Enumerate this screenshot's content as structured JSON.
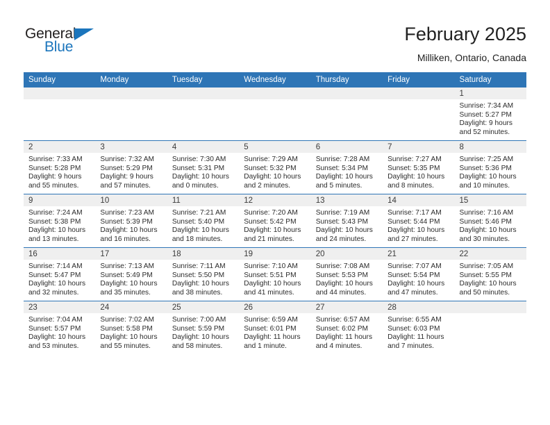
{
  "brand": {
    "name_dark": "General",
    "name_blue": "Blue",
    "accent_color": "#1B75BC"
  },
  "header": {
    "title": "February 2025",
    "subtitle": "Milliken, Ontario, Canada",
    "header_bg_color": "#2E75B6",
    "day_band_color": "#EFEFEF"
  },
  "weekday_headers": [
    "Sunday",
    "Monday",
    "Tuesday",
    "Wednesday",
    "Thursday",
    "Friday",
    "Saturday"
  ],
  "weeks": [
    [
      {
        "day": "",
        "sunrise": "",
        "sunset": "",
        "daylight_1": "",
        "daylight_2": ""
      },
      {
        "day": "",
        "sunrise": "",
        "sunset": "",
        "daylight_1": "",
        "daylight_2": ""
      },
      {
        "day": "",
        "sunrise": "",
        "sunset": "",
        "daylight_1": "",
        "daylight_2": ""
      },
      {
        "day": "",
        "sunrise": "",
        "sunset": "",
        "daylight_1": "",
        "daylight_2": ""
      },
      {
        "day": "",
        "sunrise": "",
        "sunset": "",
        "daylight_1": "",
        "daylight_2": ""
      },
      {
        "day": "",
        "sunrise": "",
        "sunset": "",
        "daylight_1": "",
        "daylight_2": ""
      },
      {
        "day": "1",
        "sunrise": "Sunrise: 7:34 AM",
        "sunset": "Sunset: 5:27 PM",
        "daylight_1": "Daylight: 9 hours",
        "daylight_2": "and 52 minutes."
      }
    ],
    [
      {
        "day": "2",
        "sunrise": "Sunrise: 7:33 AM",
        "sunset": "Sunset: 5:28 PM",
        "daylight_1": "Daylight: 9 hours",
        "daylight_2": "and 55 minutes."
      },
      {
        "day": "3",
        "sunrise": "Sunrise: 7:32 AM",
        "sunset": "Sunset: 5:29 PM",
        "daylight_1": "Daylight: 9 hours",
        "daylight_2": "and 57 minutes."
      },
      {
        "day": "4",
        "sunrise": "Sunrise: 7:30 AM",
        "sunset": "Sunset: 5:31 PM",
        "daylight_1": "Daylight: 10 hours",
        "daylight_2": "and 0 minutes."
      },
      {
        "day": "5",
        "sunrise": "Sunrise: 7:29 AM",
        "sunset": "Sunset: 5:32 PM",
        "daylight_1": "Daylight: 10 hours",
        "daylight_2": "and 2 minutes."
      },
      {
        "day": "6",
        "sunrise": "Sunrise: 7:28 AM",
        "sunset": "Sunset: 5:34 PM",
        "daylight_1": "Daylight: 10 hours",
        "daylight_2": "and 5 minutes."
      },
      {
        "day": "7",
        "sunrise": "Sunrise: 7:27 AM",
        "sunset": "Sunset: 5:35 PM",
        "daylight_1": "Daylight: 10 hours",
        "daylight_2": "and 8 minutes."
      },
      {
        "day": "8",
        "sunrise": "Sunrise: 7:25 AM",
        "sunset": "Sunset: 5:36 PM",
        "daylight_1": "Daylight: 10 hours",
        "daylight_2": "and 10 minutes."
      }
    ],
    [
      {
        "day": "9",
        "sunrise": "Sunrise: 7:24 AM",
        "sunset": "Sunset: 5:38 PM",
        "daylight_1": "Daylight: 10 hours",
        "daylight_2": "and 13 minutes."
      },
      {
        "day": "10",
        "sunrise": "Sunrise: 7:23 AM",
        "sunset": "Sunset: 5:39 PM",
        "daylight_1": "Daylight: 10 hours",
        "daylight_2": "and 16 minutes."
      },
      {
        "day": "11",
        "sunrise": "Sunrise: 7:21 AM",
        "sunset": "Sunset: 5:40 PM",
        "daylight_1": "Daylight: 10 hours",
        "daylight_2": "and 18 minutes."
      },
      {
        "day": "12",
        "sunrise": "Sunrise: 7:20 AM",
        "sunset": "Sunset: 5:42 PM",
        "daylight_1": "Daylight: 10 hours",
        "daylight_2": "and 21 minutes."
      },
      {
        "day": "13",
        "sunrise": "Sunrise: 7:19 AM",
        "sunset": "Sunset: 5:43 PM",
        "daylight_1": "Daylight: 10 hours",
        "daylight_2": "and 24 minutes."
      },
      {
        "day": "14",
        "sunrise": "Sunrise: 7:17 AM",
        "sunset": "Sunset: 5:44 PM",
        "daylight_1": "Daylight: 10 hours",
        "daylight_2": "and 27 minutes."
      },
      {
        "day": "15",
        "sunrise": "Sunrise: 7:16 AM",
        "sunset": "Sunset: 5:46 PM",
        "daylight_1": "Daylight: 10 hours",
        "daylight_2": "and 30 minutes."
      }
    ],
    [
      {
        "day": "16",
        "sunrise": "Sunrise: 7:14 AM",
        "sunset": "Sunset: 5:47 PM",
        "daylight_1": "Daylight: 10 hours",
        "daylight_2": "and 32 minutes."
      },
      {
        "day": "17",
        "sunrise": "Sunrise: 7:13 AM",
        "sunset": "Sunset: 5:49 PM",
        "daylight_1": "Daylight: 10 hours",
        "daylight_2": "and 35 minutes."
      },
      {
        "day": "18",
        "sunrise": "Sunrise: 7:11 AM",
        "sunset": "Sunset: 5:50 PM",
        "daylight_1": "Daylight: 10 hours",
        "daylight_2": "and 38 minutes."
      },
      {
        "day": "19",
        "sunrise": "Sunrise: 7:10 AM",
        "sunset": "Sunset: 5:51 PM",
        "daylight_1": "Daylight: 10 hours",
        "daylight_2": "and 41 minutes."
      },
      {
        "day": "20",
        "sunrise": "Sunrise: 7:08 AM",
        "sunset": "Sunset: 5:53 PM",
        "daylight_1": "Daylight: 10 hours",
        "daylight_2": "and 44 minutes."
      },
      {
        "day": "21",
        "sunrise": "Sunrise: 7:07 AM",
        "sunset": "Sunset: 5:54 PM",
        "daylight_1": "Daylight: 10 hours",
        "daylight_2": "and 47 minutes."
      },
      {
        "day": "22",
        "sunrise": "Sunrise: 7:05 AM",
        "sunset": "Sunset: 5:55 PM",
        "daylight_1": "Daylight: 10 hours",
        "daylight_2": "and 50 minutes."
      }
    ],
    [
      {
        "day": "23",
        "sunrise": "Sunrise: 7:04 AM",
        "sunset": "Sunset: 5:57 PM",
        "daylight_1": "Daylight: 10 hours",
        "daylight_2": "and 53 minutes."
      },
      {
        "day": "24",
        "sunrise": "Sunrise: 7:02 AM",
        "sunset": "Sunset: 5:58 PM",
        "daylight_1": "Daylight: 10 hours",
        "daylight_2": "and 55 minutes."
      },
      {
        "day": "25",
        "sunrise": "Sunrise: 7:00 AM",
        "sunset": "Sunset: 5:59 PM",
        "daylight_1": "Daylight: 10 hours",
        "daylight_2": "and 58 minutes."
      },
      {
        "day": "26",
        "sunrise": "Sunrise: 6:59 AM",
        "sunset": "Sunset: 6:01 PM",
        "daylight_1": "Daylight: 11 hours",
        "daylight_2": "and 1 minute."
      },
      {
        "day": "27",
        "sunrise": "Sunrise: 6:57 AM",
        "sunset": "Sunset: 6:02 PM",
        "daylight_1": "Daylight: 11 hours",
        "daylight_2": "and 4 minutes."
      },
      {
        "day": "28",
        "sunrise": "Sunrise: 6:55 AM",
        "sunset": "Sunset: 6:03 PM",
        "daylight_1": "Daylight: 11 hours",
        "daylight_2": "and 7 minutes."
      },
      {
        "day": "",
        "sunrise": "",
        "sunset": "",
        "daylight_1": "",
        "daylight_2": ""
      }
    ]
  ]
}
